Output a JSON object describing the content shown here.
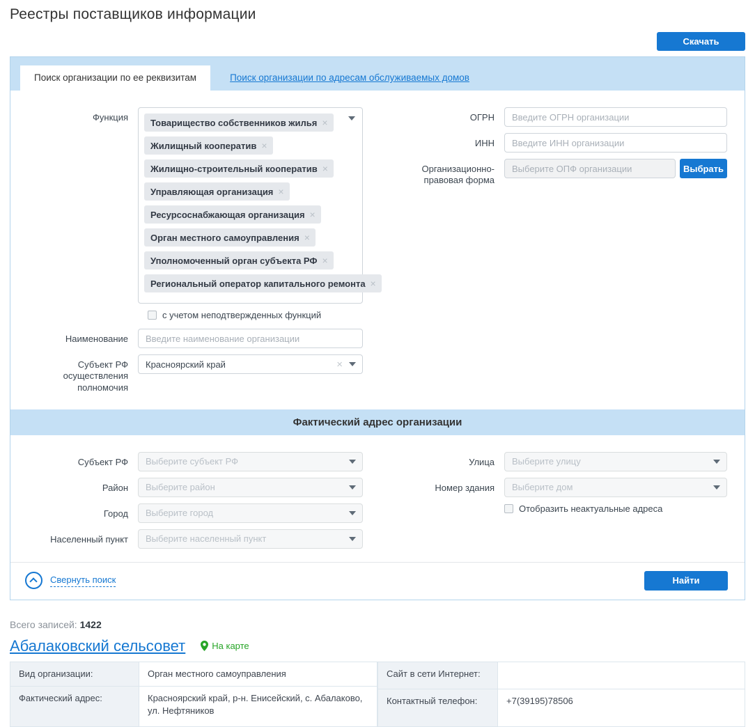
{
  "page": {
    "title": "Реестры поставщиков информации",
    "download_button": "Скачать"
  },
  "tabs": {
    "active": "Поиск организации по ее реквизитам",
    "link": "Поиск организации по адресам обслуживаемых домов"
  },
  "form": {
    "function": {
      "label": "Функция",
      "tags": [
        "Товарищество собственников жилья",
        "Жилищный кооператив",
        "Жилищно-строительный кооператив",
        "Управляющая организация",
        "Ресурсоснабжающая организация",
        "Орган местного самоуправления",
        "Уполномоченный орган субъекта РФ",
        "Региональный оператор капитального ремонта"
      ]
    },
    "unconfirmed_functions_label": "с учетом неподтвержденных функций",
    "name": {
      "label": "Наименование",
      "placeholder": "Введите наименование организации"
    },
    "subject_rf_authority": {
      "label": "Субъект РФ осуществления полномочия",
      "value": "Красноярский край"
    },
    "ogrn": {
      "label": "ОГРН",
      "placeholder": "Введите ОГРН организации"
    },
    "inn": {
      "label": "ИНН",
      "placeholder": "Введите ИНН организации"
    },
    "opf": {
      "label": "Организационно-правовая форма",
      "placeholder": "Выберите ОПФ организации",
      "choose_button": "Выбрать"
    }
  },
  "address": {
    "title": "Фактический адрес организации",
    "subject": {
      "label": "Субъект РФ",
      "placeholder": "Выберите субъект РФ"
    },
    "district": {
      "label": "Район",
      "placeholder": "Выберите район"
    },
    "city": {
      "label": "Город",
      "placeholder": "Выберите город"
    },
    "settlement": {
      "label": "Населенный пункт",
      "placeholder": "Выберите населенный пункт"
    },
    "street": {
      "label": "Улица",
      "placeholder": "Выберите улицу"
    },
    "building": {
      "label": "Номер здания",
      "placeholder": "Выберите дом"
    },
    "show_inactive_label": "Отобразить неактуальные адреса"
  },
  "actions": {
    "collapse_search": "Свернуть поиск",
    "find_button": "Найти"
  },
  "results": {
    "total_label": "Всего записей:",
    "total_value": "1422",
    "org_name": "Абалаковский сельсовет",
    "on_map": "На карте",
    "details": {
      "org_type_label": "Вид организации:",
      "org_type_value": "Орган местного самоуправления",
      "address_label": "Фактический адрес:",
      "address_value": "Красноярский край, р-н. Енисейский, с. Абалаково, ул. Нефтяников",
      "website_label": "Сайт в сети Интернет:",
      "website_value": "",
      "phone_label": "Контактный телефон:",
      "phone_value": "+7(39195)78506"
    }
  },
  "colors": {
    "accent_blue": "#1678d2",
    "strip_blue": "#c5e0f5",
    "map_green": "#27a527"
  }
}
